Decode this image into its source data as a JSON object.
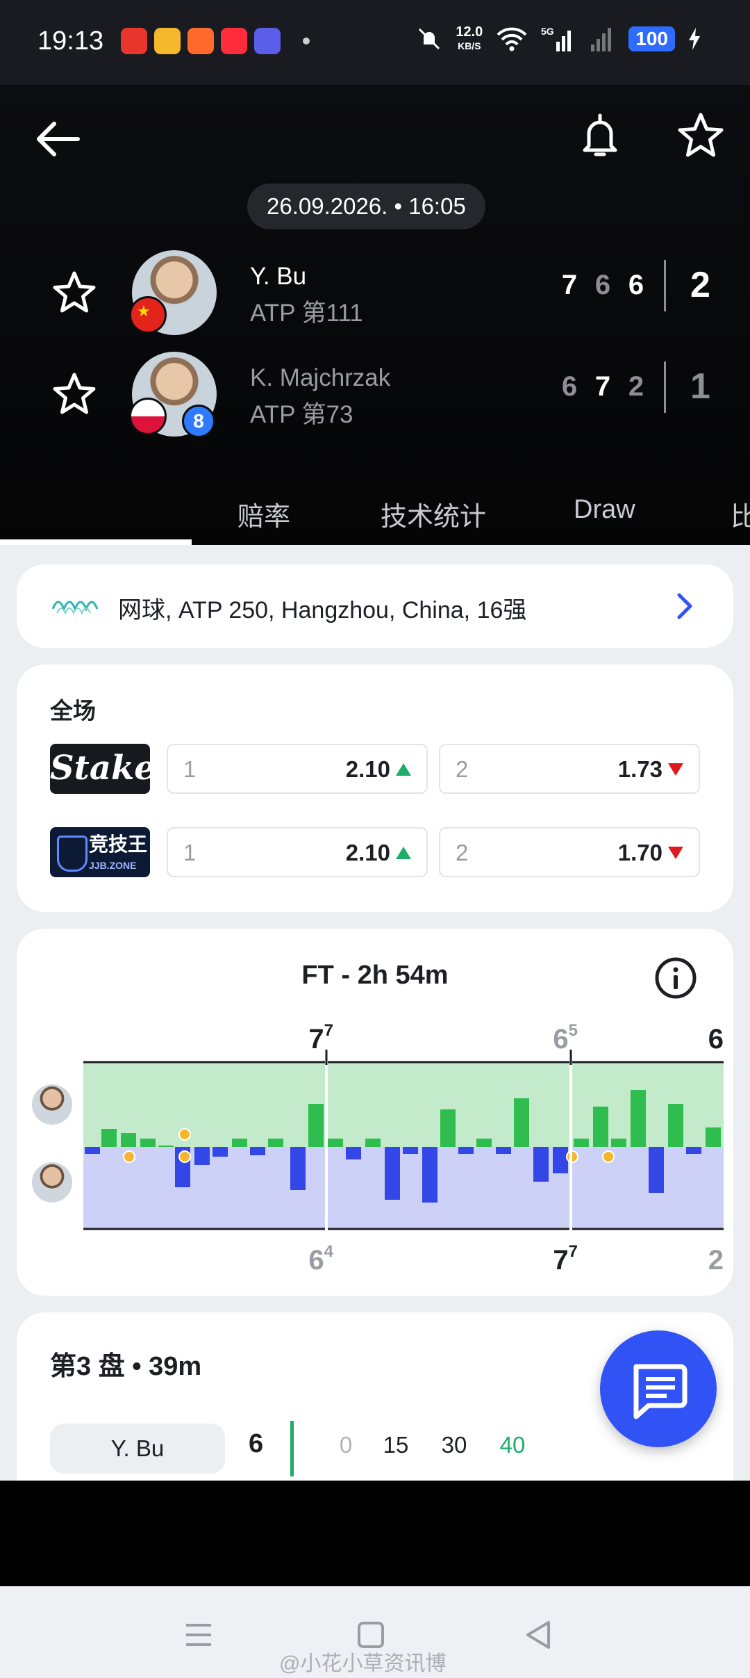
{
  "status_bar": {
    "time": "19:13",
    "net_speed": "12.0",
    "net_unit": "KB/S",
    "network": "5G",
    "battery": "100"
  },
  "header": {
    "date_time": "26.09.2026. • 16:05",
    "players": [
      {
        "name": "Y. Bu",
        "rank": "ATP 第111",
        "flag": "CN",
        "sets": [
          "7",
          "6",
          "6"
        ],
        "total": "2",
        "winner": true
      },
      {
        "name": "K. Majchrzak",
        "rank": "ATP 第73",
        "flag": "PL",
        "seed": "8",
        "sets": [
          "6",
          "7",
          "2"
        ],
        "total": "1",
        "winner": false
      }
    ],
    "tabs": [
      "赔率",
      "技术统计",
      "Draw",
      "比"
    ]
  },
  "tournament": {
    "label": "网球, ATP 250, Hangzhou, China, 16强"
  },
  "odds": {
    "title": "全场",
    "bookmakers": [
      {
        "name": "Stake",
        "home_label": "1",
        "home_value": "2.10",
        "home_trend": "up",
        "away_label": "2",
        "away_value": "1.73",
        "away_trend": "down"
      },
      {
        "name": "竞技王",
        "sub": "JJB.ZONE",
        "home_label": "1",
        "home_value": "2.10",
        "home_trend": "up",
        "away_label": "2",
        "away_value": "1.70",
        "away_trend": "down"
      }
    ]
  },
  "momentum": {
    "title": "FT - 2h 54m",
    "top_scores": [
      {
        "games": "7",
        "tiebreak": "7"
      },
      {
        "games": "6",
        "tiebreak": "5"
      },
      {
        "games": "6",
        "tiebreak": ""
      }
    ],
    "bottom_scores": [
      {
        "games": "6",
        "tiebreak": "4"
      },
      {
        "games": "7",
        "tiebreak": "7"
      },
      {
        "games": "2",
        "tiebreak": ""
      }
    ],
    "colors": {
      "player1_area": "#c3ebcb",
      "player1_bar": "#2ebd4e",
      "player2_area": "#cdd1f7",
      "player2_bar": "#3346e6"
    }
  },
  "set3": {
    "title": "第3 盘 • 39m",
    "player": "Y. Bu",
    "games": "6",
    "points": [
      "0",
      "15",
      "30",
      "40"
    ]
  },
  "watermark": "@小花小草资讯博"
}
